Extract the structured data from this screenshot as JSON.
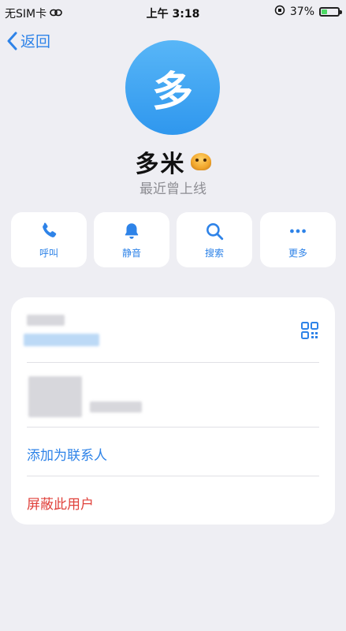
{
  "status_bar": {
    "carrier": "无SIM卡",
    "time": "上午 3:18",
    "battery": "37%",
    "battery_level": 0.37
  },
  "nav": {
    "back_label": "返回"
  },
  "profile": {
    "avatar_char": "多",
    "name": "多米",
    "last_seen": "最近曾上线",
    "avatar_color": "#3aa3f2"
  },
  "actions": [
    {
      "label": "呼叫",
      "icon": "phone-icon"
    },
    {
      "label": "静音",
      "icon": "bell-icon"
    },
    {
      "label": "搜索",
      "icon": "search-icon"
    },
    {
      "label": "更多",
      "icon": "more-icon"
    }
  ],
  "card": {
    "add_contact": "添加为联系人",
    "block_user": "屏蔽此用户"
  },
  "colors": {
    "accent": "#2e83e8",
    "danger": "#e0413b",
    "background": "#eeeef3"
  }
}
